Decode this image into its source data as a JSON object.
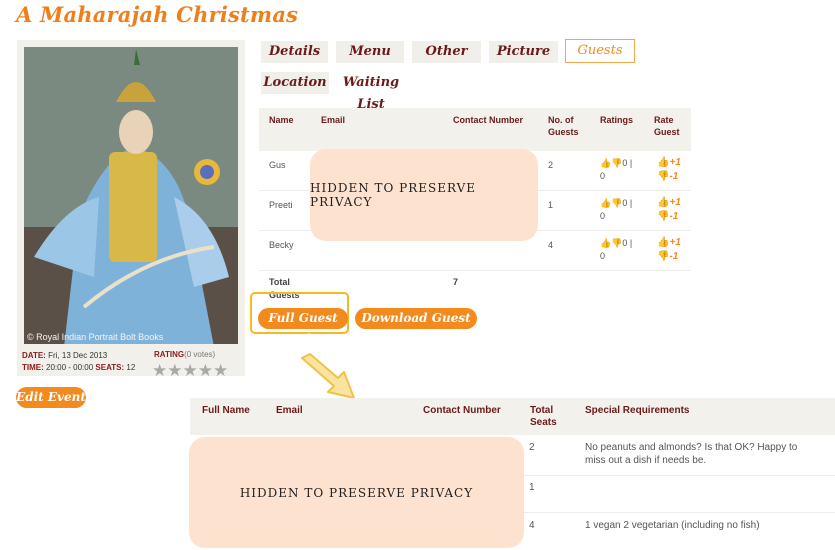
{
  "page_title": "A Maharajah Christmas",
  "event": {
    "image_credit": "© Royal Indian Portrait Bolt Books",
    "date_label": "DATE:",
    "date_value": "Fri, 13 Dec 2013",
    "time_label": "TIME:",
    "time_value": "20:00 - 00:00",
    "seats_label": "SEATS:",
    "seats_value": "12",
    "rating_label": "RATING",
    "rating_votes": "(0 votes)",
    "stars": "★★★★★",
    "edit_button": "Edit Event"
  },
  "tabs": [
    "Details",
    "Menu",
    "Other",
    "Picture",
    "Guests",
    "Location",
    "Waiting List"
  ],
  "active_tab": "Guests",
  "guest_table": {
    "headers": [
      "Name",
      "Email",
      "Contact Number",
      "No. of Guests",
      "Ratings",
      "Rate Guest"
    ],
    "rows": [
      {
        "name": "Gus",
        "guests": "2",
        "ratings_top": "👍👎0 |",
        "ratings_bottom": "0"
      },
      {
        "name": "Preeti",
        "guests": "1",
        "ratings_top": "👍👎0 |",
        "ratings_bottom": "0"
      },
      {
        "name": "Becky",
        "guests": "4",
        "ratings_top": "👍👎0 |",
        "ratings_bottom": "0"
      }
    ],
    "rate_plus": "+1",
    "rate_minus": "-1",
    "total_label": "Total Guests",
    "total_value": "7"
  },
  "privacy_text": "HIDDEN TO PRESERVE PRIVACY",
  "buttons": {
    "full_guest_info": "Full Guest Info",
    "download_guest_list": "Download Guest List"
  },
  "full_table": {
    "headers": [
      "Full Name",
      "Email",
      "Contact Number",
      "Total Seats",
      "Special Requirements"
    ],
    "rows": [
      {
        "seats": "2",
        "requirements": "No peanuts and almonds? Is that OK? Happy to miss out a dish if needs be."
      },
      {
        "seats": "1",
        "requirements": ""
      },
      {
        "seats": "4",
        "requirements": "1 vegan 2 vegetarian (including no fish)"
      }
    ]
  },
  "colors": {
    "accent": "#f28a1e",
    "heading": "#6b1a1a",
    "privacy_bg": "#fde2d0",
    "highlight": "#f6b820"
  }
}
